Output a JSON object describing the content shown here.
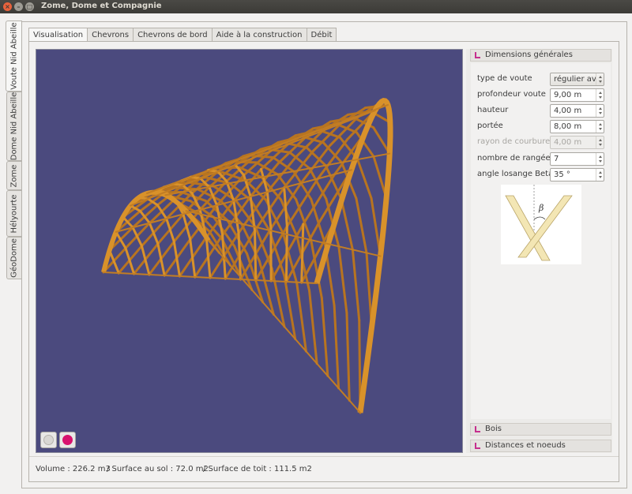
{
  "window": {
    "title": "Zome, Dome et Compagnie"
  },
  "side_tabs": [
    {
      "label": "Voute Nid Abeille",
      "active": true
    },
    {
      "label": "Dome Nid Abeille",
      "active": false
    },
    {
      "label": "Zome",
      "active": false
    },
    {
      "label": "Hélyourte",
      "active": false
    },
    {
      "label": "GéoDome",
      "active": false
    }
  ],
  "top_tabs": [
    {
      "label": "Visualisation",
      "active": true
    },
    {
      "label": "Chevrons",
      "active": false
    },
    {
      "label": "Chevrons de bord",
      "active": false
    },
    {
      "label": "Aide à la construction",
      "active": false
    },
    {
      "label": "Débit",
      "active": false
    }
  ],
  "sections": {
    "general": "Dimensions générales",
    "bois": "Bois",
    "distances": "Distances et noeuds"
  },
  "form": [
    {
      "label": "type de voute",
      "value": "régulier avec",
      "kind": "combo",
      "enabled": true
    },
    {
      "label": "profondeur voute",
      "value": "9,00 m",
      "kind": "spin",
      "enabled": true
    },
    {
      "label": "hauteur",
      "value": "4,00 m",
      "kind": "spin",
      "enabled": true
    },
    {
      "label": "portée",
      "value": "8,00 m",
      "kind": "spin",
      "enabled": true
    },
    {
      "label": "rayon de courbure",
      "value": "4,00 m",
      "kind": "spin",
      "enabled": false
    },
    {
      "label": "nombre de rangées",
      "value": "7",
      "kind": "spin",
      "enabled": true
    },
    {
      "label": "angle losange Beta",
      "value": "35 °",
      "kind": "spin",
      "enabled": true
    }
  ],
  "diagram": {
    "symbol": "β"
  },
  "status": {
    "volume": "Volume : 226.2 m3",
    "surface_sol": "/ Surface au sol : 72.0 m2",
    "surface_toit": "/ Surface de toit : 111.5 m2"
  },
  "colors": {
    "viewport_bg": "#4b4a7e",
    "wood": "#d9922a",
    "record_button": "#d8126e",
    "section_arrow": "#c62f8e"
  }
}
